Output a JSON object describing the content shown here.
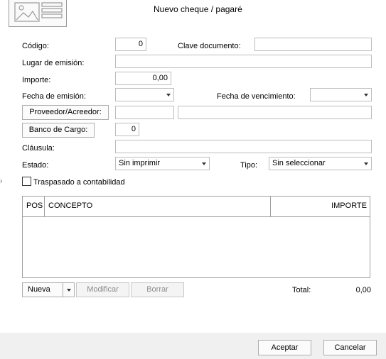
{
  "dialog": {
    "title": "Nuevo cheque / pagaré"
  },
  "form": {
    "codigo_label": "Código:",
    "codigo_value": "0",
    "clave_label": "Clave documento:",
    "clave_value": "",
    "lugar_label": "Lugar de emisión:",
    "lugar_value": "",
    "importe_label": "Importe:",
    "importe_value": "0,00",
    "fecha_emision_label": "Fecha de emisión:",
    "fecha_emision_value": "",
    "fecha_venc_label": "Fecha de vencimiento:",
    "fecha_venc_value": "",
    "proveedor_button": "Proveedor/Acreedor:",
    "proveedor_code": "",
    "proveedor_name": "",
    "banco_button": "Banco de Cargo:",
    "banco_value": "0",
    "clausula_label": "Cláusula:",
    "clausula_value": "",
    "estado_label": "Estado:",
    "estado_value": "Sin imprimir",
    "tipo_label": "Tipo:",
    "tipo_value": "Sin seleccionar",
    "traspasado_label": "Traspasado a contabilidad",
    "traspasado_checked": false
  },
  "grid": {
    "columns": [
      "POS",
      "CONCEPTO",
      "IMPORTE"
    ],
    "rows": []
  },
  "actions": {
    "nueva": "Nueva",
    "modificar": "Modificar",
    "borrar": "Borrar",
    "total_label": "Total:",
    "total_value": "0,00"
  },
  "footer": {
    "aceptar": "Aceptar",
    "cancelar": "Cancelar"
  },
  "colors": {
    "border": "#bdbdbd",
    "footer_bg": "#f0f0f0",
    "grid_border": "#a0a0a0"
  }
}
